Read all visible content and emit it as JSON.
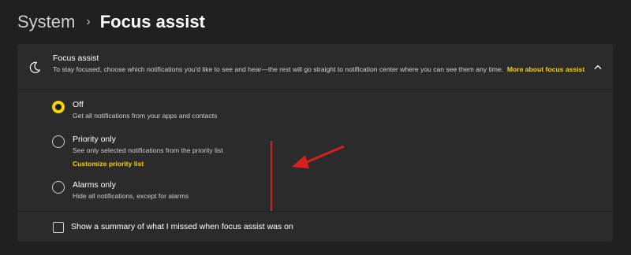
{
  "breadcrumb": {
    "parent": "System",
    "separator": "›",
    "current": "Focus assist"
  },
  "focus_assist": {
    "icon": "moon-icon",
    "title": "Focus assist",
    "description": "To stay focused, choose which notifications you'd like to see and hear—the rest will go straight to notification center where you can see them any time.",
    "more_link": "More about focus assist",
    "expanded": true
  },
  "options": [
    {
      "title": "Off",
      "description": "Get all notifications from your apps and contacts",
      "selected": true
    },
    {
      "title": "Priority only",
      "description": "See only selected notifications from the priority list",
      "link": "Customize priority list",
      "selected": false
    },
    {
      "title": "Alarms only",
      "description": "Hide all notifications, except for alarms",
      "selected": false
    }
  ],
  "summary_checkbox": {
    "label": "Show a summary of what I missed when focus assist was on",
    "checked": false
  },
  "colors": {
    "background": "#202020",
    "card": "#2b2b2b",
    "accent": "#f5d400",
    "annotation_red": "#d61f1f"
  }
}
